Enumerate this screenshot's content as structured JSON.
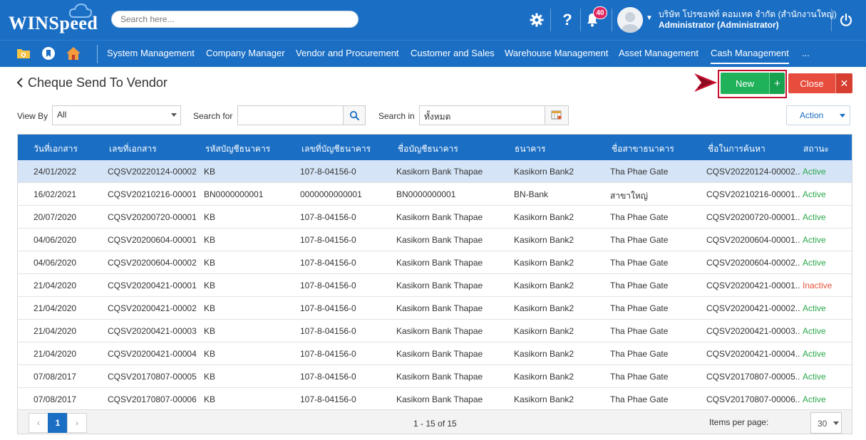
{
  "header": {
    "logo_text": "WINSpeed",
    "search_placeholder": "Search here...",
    "notification_count": "40",
    "user_company": "บริษัท โปรซอฟท์ คอมเทค จำกัด (สำนักงานใหญ่)",
    "user_role": "Administrator (Administrator)"
  },
  "menu": {
    "items": [
      "System Management",
      "Company Manager",
      "Vendor and Procurement",
      "Customer and Sales",
      "Warehouse Management",
      "Asset Management",
      "Cash Management",
      "..."
    ],
    "active_index": 6
  },
  "page": {
    "title": "Cheque Send To Vendor",
    "new_label": "New",
    "close_label": "Close"
  },
  "filters": {
    "view_by_label": "View By",
    "view_by_value": "All",
    "search_for_label": "Search for",
    "search_for_value": "",
    "search_in_label": "Search in",
    "search_in_value": "ทั้งหมด",
    "action_label": "Action"
  },
  "table": {
    "columns": [
      "วันที่เอกสาร",
      "เลขที่เอกสาร",
      "รหัสบัญชีธนาคาร",
      "เลขที่บัญชีธนาคาร",
      "ชื่อบัญชีธนาคาร",
      "ธนาคาร",
      "ชื่อสาขาธนาคาร",
      "ชื่อในการค้นหา",
      "สถานะ"
    ],
    "rows": [
      [
        "24/01/2022",
        "CQSV20220124-00002",
        "KB",
        "107-8-04156-0",
        "Kasikorn Bank Thapae",
        "Kasikorn Bank2",
        "Tha Phae Gate",
        "CQSV20220124-00002...",
        "Active"
      ],
      [
        "16/02/2021",
        "CQSV20210216-00001",
        "BN0000000001",
        "0000000000001",
        "BN0000000001",
        "BN-Bank",
        "สาขาใหญ่",
        "CQSV20210216-00001...",
        "Active"
      ],
      [
        "20/07/2020",
        "CQSV20200720-00001",
        "KB",
        "107-8-04156-0",
        "Kasikorn Bank Thapae",
        "Kasikorn Bank2",
        "Tha Phae Gate",
        "CQSV20200720-00001...",
        "Active"
      ],
      [
        "04/06/2020",
        "CQSV20200604-00001",
        "KB",
        "107-8-04156-0",
        "Kasikorn Bank Thapae",
        "Kasikorn Bank2",
        "Tha Phae Gate",
        "CQSV20200604-00001...",
        "Active"
      ],
      [
        "04/06/2020",
        "CQSV20200604-00002",
        "KB",
        "107-8-04156-0",
        "Kasikorn Bank Thapae",
        "Kasikorn Bank2",
        "Tha Phae Gate",
        "CQSV20200604-00002...",
        "Active"
      ],
      [
        "21/04/2020",
        "CQSV20200421-00001",
        "KB",
        "107-8-04156-0",
        "Kasikorn Bank Thapae",
        "Kasikorn Bank2",
        "Tha Phae Gate",
        "CQSV20200421-00001...",
        "Inactive"
      ],
      [
        "21/04/2020",
        "CQSV20200421-00002",
        "KB",
        "107-8-04156-0",
        "Kasikorn Bank Thapae",
        "Kasikorn Bank2",
        "Tha Phae Gate",
        "CQSV20200421-00002...",
        "Active"
      ],
      [
        "21/04/2020",
        "CQSV20200421-00003",
        "KB",
        "107-8-04156-0",
        "Kasikorn Bank Thapae",
        "Kasikorn Bank2",
        "Tha Phae Gate",
        "CQSV20200421-00003...",
        "Active"
      ],
      [
        "21/04/2020",
        "CQSV20200421-00004",
        "KB",
        "107-8-04156-0",
        "Kasikorn Bank Thapae",
        "Kasikorn Bank2",
        "Tha Phae Gate",
        "CQSV20200421-00004...",
        "Active"
      ],
      [
        "07/08/2017",
        "CQSV20170807-00005",
        "KB",
        "107-8-04156-0",
        "Kasikorn Bank Thapae",
        "Kasikorn Bank2",
        "Tha Phae Gate",
        "CQSV20170807-00005...",
        "Active"
      ],
      [
        "07/08/2017",
        "CQSV20170807-00006",
        "KB",
        "107-8-04156-0",
        "Kasikorn Bank Thapae",
        "Kasikorn Bank2",
        "Tha Phae Gate",
        "CQSV20170807-00006...",
        "Active"
      ]
    ],
    "selected_row": 0
  },
  "pager": {
    "prev": "‹",
    "current_page": "1",
    "next": "›",
    "info": "1 - 15 of 15",
    "items_per_page_label": "Items per page:",
    "items_per_page_value": "30"
  },
  "colors": {
    "primary": "#1a6ec4",
    "new_button": "#1fb25a",
    "close_button": "#e84c3d",
    "status_active": "#2aa84a",
    "status_inactive": "#e5533d",
    "highlight_frame": "#c8102e"
  }
}
